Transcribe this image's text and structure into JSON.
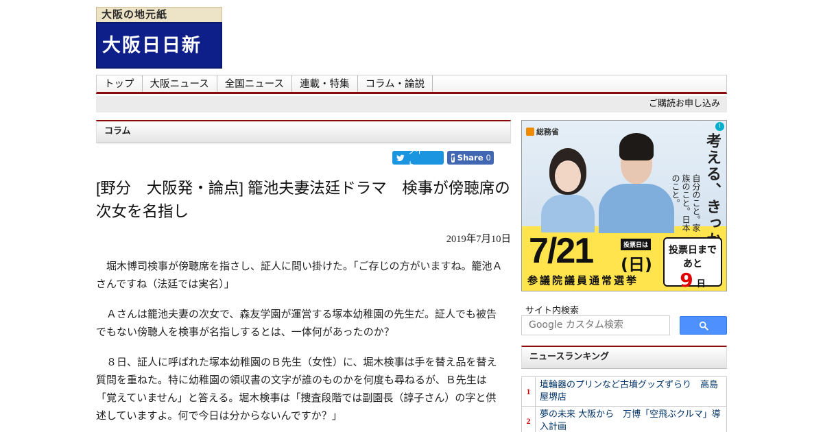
{
  "header": {
    "tagline": "大阪の地元紙",
    "logo_text": "大阪日日新聞"
  },
  "nav": {
    "items": [
      "トップ",
      "大阪ニュース",
      "全国ニュース",
      "連載・特集",
      "コラム・論説"
    ],
    "subscribe_link": "ご購読お申し込み"
  },
  "section": {
    "label": "コラム"
  },
  "share": {
    "tweet_label": "ツイート",
    "facebook_label": "Share",
    "facebook_count": "0"
  },
  "article": {
    "title": "[野分　大阪発・論点] 籠池夫妻法廷ドラマ　検事が傍聴席の次女を名指し",
    "date": "2019年7月10日",
    "paragraphs": [
      "堀木博司検事が傍聴席を指さし、証人に問い掛けた。「ご存じの方がいますね。籠池Ａさんですね（法廷では実名）」",
      "Ａさんは籠池夫妻の次女で、森友学園が運営する塚本幼稚園の先生だ。証人でも被告でもない傍聴人を検事が名指しするとは、一体何があったのか？",
      "８日、証人に呼ばれた塚本幼稚園のＢ先生（女性）に、堀木検事は手を替え品を替え質問を重ねた。特に幼稚園の領収書の文字が誰のものかを何度も尋ねるが、Ｂ先生は「覚えていません」と答える。堀木検事は「捜査段階では副園長（諄子さん）の字と供述していますよ。何で今日は分からないんですか？」"
    ]
  },
  "ad": {
    "ministry": "総務省",
    "headline": "考える、きっかけ。",
    "subcopy": "自分のこと。家族のこと。日本のこと。",
    "date": "7/21",
    "day": "(日)",
    "tag": "投票日は",
    "election": "参議院議員通常選挙",
    "countdown_label": "投票日まであと",
    "countdown_num": "9",
    "countdown_unit": "日"
  },
  "search": {
    "label": "サイト内検索",
    "placeholder": "Google カスタム検索"
  },
  "ranking": {
    "title": "ニュースランキング",
    "items": [
      {
        "rank": "1",
        "text": "埴輪器のプリンなど古墳グッズずらり　高島屋堺店"
      },
      {
        "rank": "2",
        "text": "夢の未来 大阪から　万博「空飛ぶクルマ」導入計画"
      }
    ]
  },
  "colors": {
    "logo_navy": "#0e1f8a",
    "accent_red": "#8b0a0a",
    "twitter_blue": "#1b95e0",
    "facebook_blue": "#4267b2",
    "search_blue": "#4d90fe"
  }
}
